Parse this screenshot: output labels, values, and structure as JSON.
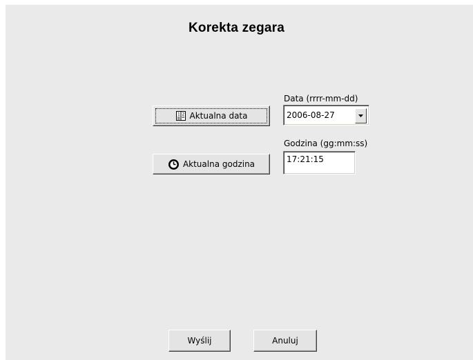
{
  "dialog": {
    "title": "Korekta zegara"
  },
  "date": {
    "button_label": "Aktualna data",
    "field_label": "Data (rrrr-mm-dd)",
    "value": "2006-08-27"
  },
  "time": {
    "button_label": "Aktualna godzina",
    "field_label": "Godzina (gg:mm:ss)",
    "value": "17:21:15"
  },
  "footer": {
    "send_label": "Wyślij",
    "cancel_label": "Anuluj"
  },
  "icons": {
    "date_button": "calendar-icon",
    "time_button": "clock-icon",
    "date_dropdown": "chevron-down-icon"
  }
}
